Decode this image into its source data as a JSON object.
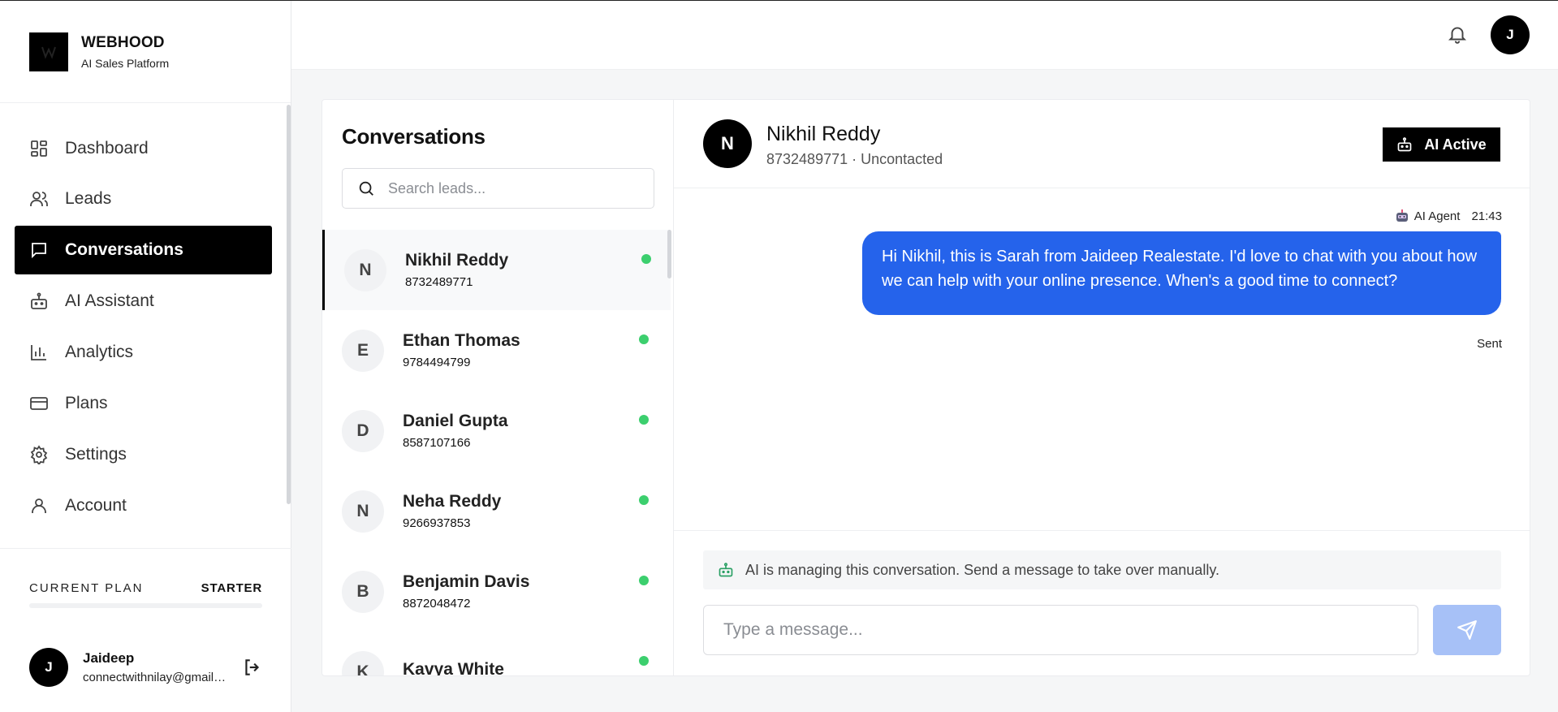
{
  "brand": {
    "name": "WEBHOOD",
    "subtitle": "AI Sales Platform"
  },
  "nav": {
    "items": [
      {
        "label": "Dashboard",
        "icon": "dashboard-icon",
        "active": false
      },
      {
        "label": "Leads",
        "icon": "users-icon",
        "active": false
      },
      {
        "label": "Conversations",
        "icon": "message-square-icon",
        "active": true
      },
      {
        "label": "AI Assistant",
        "icon": "bot-icon",
        "active": false
      },
      {
        "label": "Analytics",
        "icon": "bar-chart-icon",
        "active": false
      },
      {
        "label": "Plans",
        "icon": "credit-card-icon",
        "active": false
      },
      {
        "label": "Settings",
        "icon": "gear-icon",
        "active": false
      },
      {
        "label": "Account",
        "icon": "user-icon",
        "active": false
      }
    ]
  },
  "plan": {
    "label": "CURRENT PLAN",
    "value": "STARTER"
  },
  "user": {
    "initial": "J",
    "name": "Jaideep",
    "email": "connectwithnilay@gmail.com"
  },
  "topbar": {
    "avatar_initial": "J"
  },
  "conversations": {
    "title": "Conversations",
    "search_placeholder": "Search leads...",
    "items": [
      {
        "initial": "N",
        "name": "Nikhil Reddy",
        "phone": "8732489771",
        "online": true,
        "selected": true
      },
      {
        "initial": "E",
        "name": "Ethan Thomas",
        "phone": "9784494799",
        "online": true,
        "selected": false
      },
      {
        "initial": "D",
        "name": "Daniel Gupta",
        "phone": "8587107166",
        "online": true,
        "selected": false
      },
      {
        "initial": "N",
        "name": "Neha Reddy",
        "phone": "9266937853",
        "online": true,
        "selected": false
      },
      {
        "initial": "B",
        "name": "Benjamin Davis",
        "phone": "8872048472",
        "online": true,
        "selected": false
      },
      {
        "initial": "K",
        "name": "Kavya White",
        "phone": "",
        "online": true,
        "selected": false
      }
    ]
  },
  "chat": {
    "initial": "N",
    "name": "Nikhil Reddy",
    "subtitle": "8732489771 · Uncontacted",
    "ai_button": "AI Active",
    "message": {
      "sender": "AI Agent",
      "time": "21:43",
      "text": "Hi Nikhil, this is Sarah from Jaideep Realestate. I'd love to chat with you about how we can help with your online presence. When's a good time to connect?",
      "status": "Sent"
    },
    "ai_note": "AI is managing this conversation. Send a message to take over manually.",
    "input_placeholder": "Type a message..."
  },
  "colors": {
    "accent": "#2563eb",
    "online": "#3ccf6e",
    "send_disabled": "#a7c1f7",
    "active_nav": "#000000"
  }
}
